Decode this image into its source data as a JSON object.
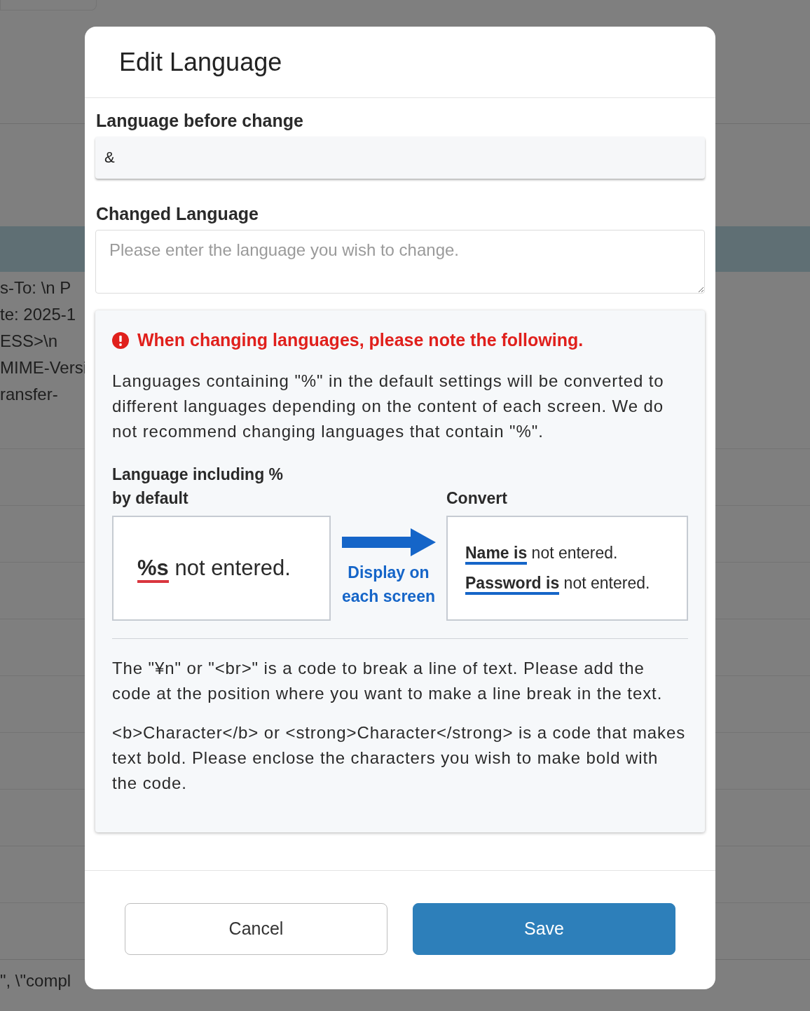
{
  "background": {
    "lines": [
      "s-To: \\n P",
      "te: 2025-1",
      "ESS>\\n",
      "MIME-Versi",
      "ransfer-"
    ],
    "bottom_text": "\", \\\"compl"
  },
  "dialog": {
    "title": "Edit Language",
    "fields": [
      {
        "kind": "readonly",
        "label": "Language before change",
        "value": "&"
      },
      {
        "kind": "textarea",
        "label": "Changed Language",
        "placeholder": "Please enter the language you wish to change."
      }
    ],
    "notice": {
      "heading": "When changing languages, please note the following.",
      "paragraph": "Languages containing \"%\" in the default settings will be converted to different languages depending on the content of each screen. We do not recommend changing languages that contain \"%\".",
      "example": {
        "source_heading": "Language including % by default",
        "target_heading": "Convert",
        "source": "**%s** not entered.",
        "arrow_caption": "Display on each screen",
        "targets": [
          "**Name is** not entered.",
          "**Password is** not entered."
        ]
      },
      "notes": [
        "The \"¥n\" or \"<br>\" is a code to break a line of text. Please add the code at the position where you want to make a line break in the text.",
        "<b>Character</b> or <strong>Character</strong> is a code that makes text bold. Please enclose the characters you wish to make bold with the code."
      ]
    },
    "buttons": [
      {
        "kind": "secondary",
        "label": "Cancel"
      },
      {
        "kind": "primary",
        "label": "Save"
      }
    ]
  }
}
